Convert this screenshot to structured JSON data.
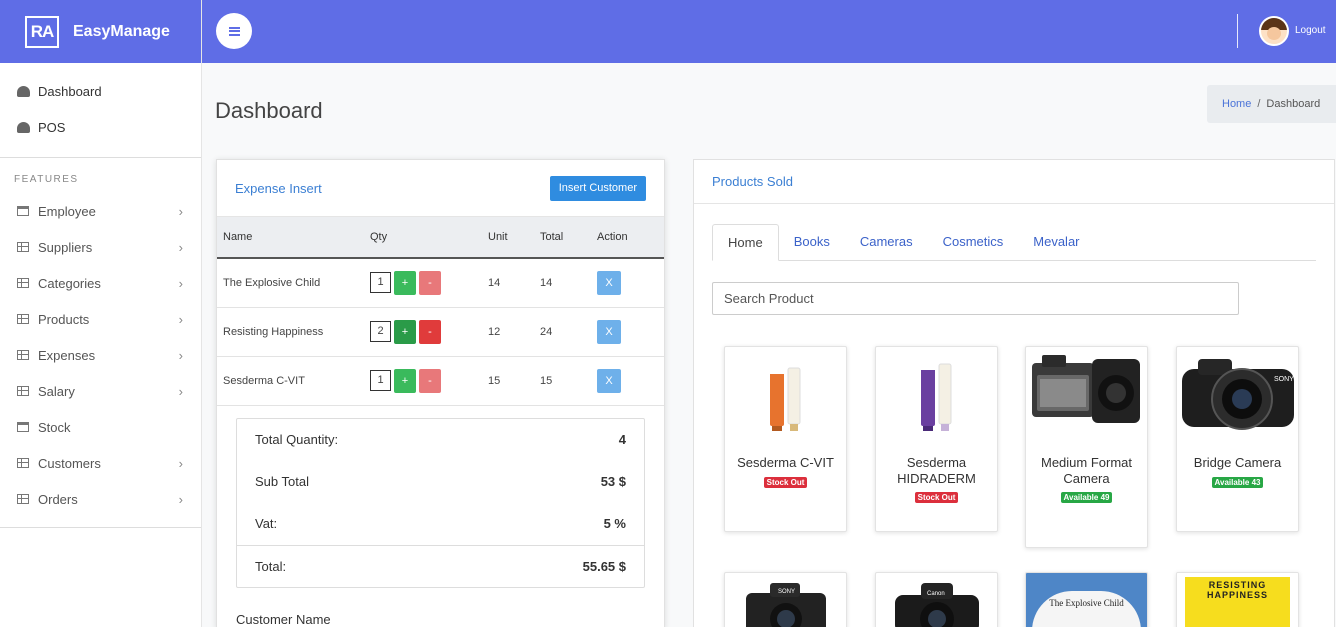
{
  "brand": {
    "logo": "RA",
    "name": "EasyManage"
  },
  "sidebar": {
    "top_items": [
      {
        "label": "Dashboard",
        "icon": "gauge-icon"
      },
      {
        "label": "POS",
        "icon": "gauge-icon"
      }
    ],
    "section_label": "FEATURES",
    "items": [
      {
        "label": "Employee",
        "icon": "window-icon",
        "has_chevron": true
      },
      {
        "label": "Suppliers",
        "icon": "document-icon",
        "has_chevron": true
      },
      {
        "label": "Categories",
        "icon": "table-icon",
        "has_chevron": true
      },
      {
        "label": "Products",
        "icon": "table-icon",
        "has_chevron": true
      },
      {
        "label": "Expenses",
        "icon": "table-icon",
        "has_chevron": true
      },
      {
        "label": "Salary",
        "icon": "table-icon",
        "has_chevron": true
      },
      {
        "label": "Stock",
        "icon": "window-icon",
        "has_chevron": false
      },
      {
        "label": "Customers",
        "icon": "table-icon",
        "has_chevron": true
      },
      {
        "label": "Orders",
        "icon": "table-icon",
        "has_chevron": true
      }
    ]
  },
  "topbar": {
    "logout_label": "Logout",
    "accent": "#5f6de6"
  },
  "page": {
    "title": "Dashboard"
  },
  "breadcrumb": {
    "home": "Home",
    "separator": "/",
    "current": "Dashboard"
  },
  "expense": {
    "title": "Expense Insert",
    "insert_button": "Insert Customer",
    "columns": [
      "Name",
      "Qty",
      "Unit",
      "Total",
      "Action"
    ],
    "rows": [
      {
        "name": "The Explosive Child",
        "qty": "1",
        "unit": "14",
        "total": "14",
        "action": "X"
      },
      {
        "name": "Resisting Happiness",
        "qty": "2",
        "unit": "12",
        "total": "24",
        "action": "X"
      },
      {
        "name": "Sesderma C-VIT",
        "qty": "1",
        "unit": "15",
        "total": "15",
        "action": "X"
      }
    ],
    "plus_label": "+",
    "minus_label": "-",
    "summary": {
      "total_quantity_label": "Total Quantity:",
      "total_quantity": "4",
      "sub_total_label": "Sub Total",
      "sub_total": "53 $",
      "vat_label": "Vat:",
      "vat": "5 %",
      "total_label": "Total:",
      "total": "55.65 $"
    },
    "customer_name_label": "Customer Name"
  },
  "products": {
    "title": "Products Sold",
    "tabs": [
      "Home",
      "Books",
      "Cameras",
      "Cosmetics",
      "Mevalar"
    ],
    "search_placeholder": "Search Product",
    "items": [
      {
        "name": "Sesderma C-VIT",
        "badge": "Stock Out",
        "status": "out"
      },
      {
        "name": "Sesderma HIDRADERM",
        "badge": "Stock Out",
        "status": "out"
      },
      {
        "name": "Medium Format Camera",
        "badge": "Available 49",
        "status": "available"
      },
      {
        "name": "Bridge Camera",
        "badge": "Available 43",
        "status": "available"
      }
    ],
    "camera_brands": [
      "SONY",
      "Canon"
    ],
    "book_titles": [
      "The Explosive Child",
      "RESISTING HAPPINESS"
    ]
  }
}
